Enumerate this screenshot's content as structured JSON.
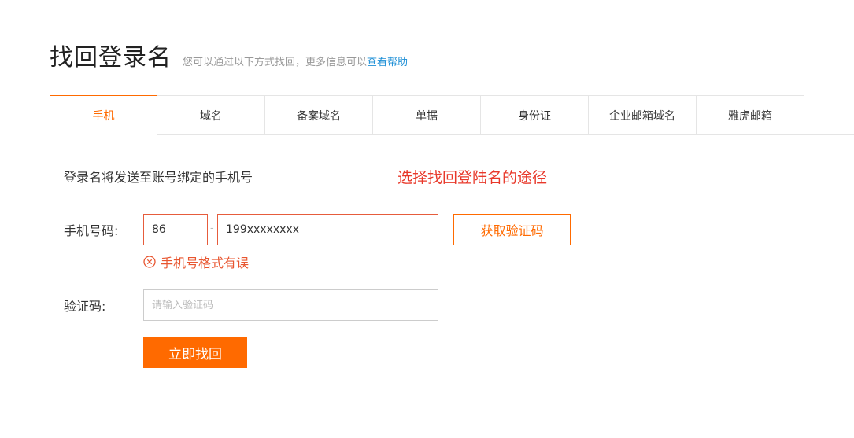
{
  "header": {
    "title": "找回登录名",
    "subtitle": "您可以通过以下方式找回，更多信息可以",
    "help_link": "查看帮助"
  },
  "tabs": [
    {
      "label": "手机",
      "active": true
    },
    {
      "label": "域名",
      "active": false
    },
    {
      "label": "备案域名",
      "active": false
    },
    {
      "label": "单据",
      "active": false
    },
    {
      "label": "身份证",
      "active": false
    },
    {
      "label": "企业邮箱域名",
      "active": false
    },
    {
      "label": "雅虎邮箱",
      "active": false
    }
  ],
  "form": {
    "hint": "登录名将发送至账号绑定的手机号",
    "annotation": "选择找回登陆名的途径",
    "phone_label": "手机号码:",
    "country_code_value": "86",
    "separator": "-",
    "phone_value": "199xxxxxxxx",
    "get_code_button": "获取验证码",
    "error_message": "手机号格式有误",
    "code_label": "验证码:",
    "code_placeholder": "请输入验证码",
    "submit_button": "立即找回"
  },
  "colors": {
    "accent": "#ff6a00",
    "error": "#e8552f",
    "annotation": "#e8382a",
    "link": "#1e8fd6"
  },
  "icons": {
    "error": "error-circle-icon"
  }
}
